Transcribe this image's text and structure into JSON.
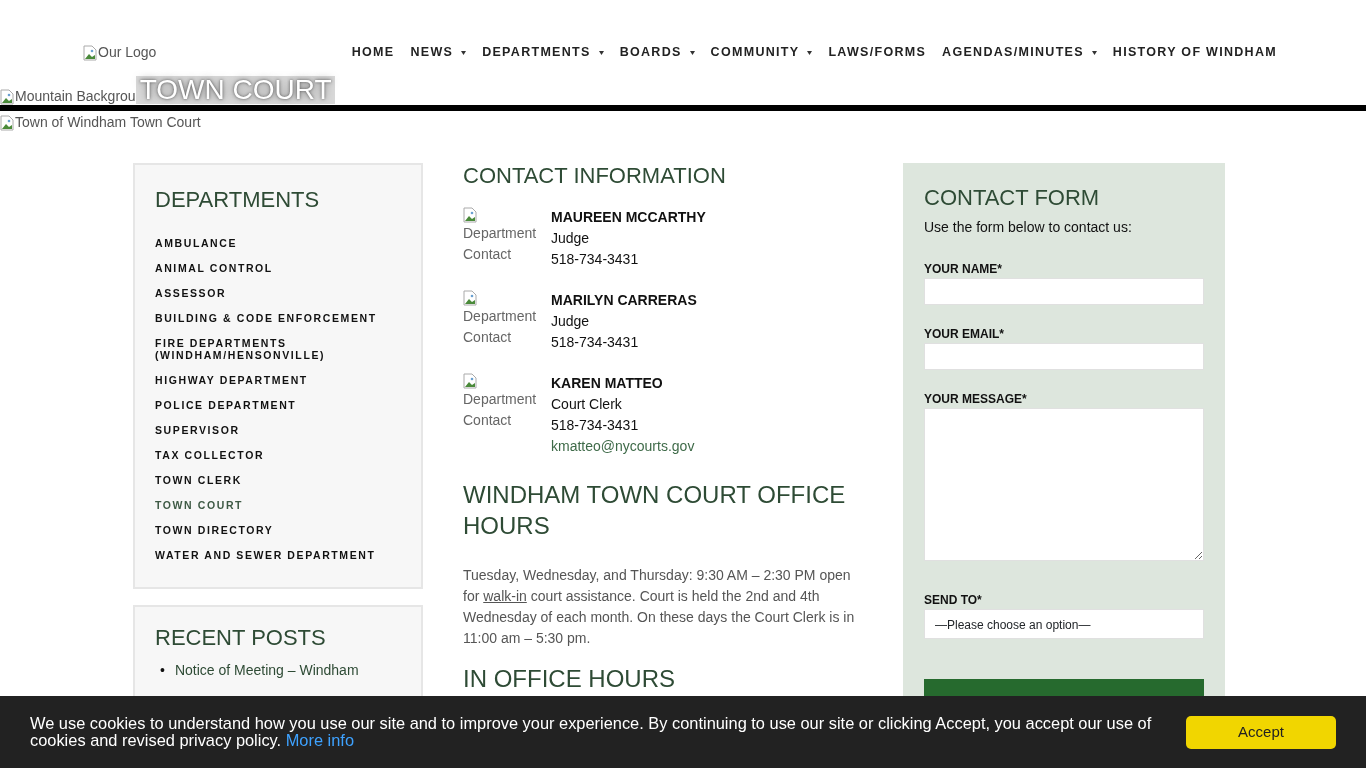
{
  "header": {
    "logo_alt": "Our Logo",
    "nav": [
      {
        "label": "HOME",
        "dropdown": false
      },
      {
        "label": "NEWS",
        "dropdown": true
      },
      {
        "label": "DEPARTMENTS",
        "dropdown": true
      },
      {
        "label": "BOARDS",
        "dropdown": true
      },
      {
        "label": "COMMUNITY",
        "dropdown": true
      },
      {
        "label": "LAWS/FORMS",
        "dropdown": false
      },
      {
        "label": "AGENDAS/MINUTES",
        "dropdown": true
      },
      {
        "label": "HISTORY OF WINDHAM",
        "dropdown": false
      }
    ]
  },
  "hero": {
    "background_alt": "Mountain Backgrou",
    "title": "TOWN COURT",
    "image_alt": "Town of Windham Town Court"
  },
  "sidebar": {
    "departments": {
      "title": "DEPARTMENTS",
      "items": [
        {
          "label": "AMBULANCE",
          "selected": false
        },
        {
          "label": "ANIMAL CONTROL",
          "selected": false
        },
        {
          "label": "ASSESSOR",
          "selected": false
        },
        {
          "label": "BUILDING & CODE ENFORCEMENT",
          "selected": false
        },
        {
          "label": "FIRE DEPARTMENTS (WINDHAM/HENSONVILLE)",
          "selected": false
        },
        {
          "label": "HIGHWAY DEPARTMENT",
          "selected": false
        },
        {
          "label": "POLICE DEPARTMENT",
          "selected": false
        },
        {
          "label": "SUPERVISOR",
          "selected": false
        },
        {
          "label": "TAX COLLECTOR",
          "selected": false
        },
        {
          "label": "TOWN CLERK",
          "selected": false
        },
        {
          "label": "TOWN COURT",
          "selected": true
        },
        {
          "label": "TOWN DIRECTORY",
          "selected": false
        },
        {
          "label": "WATER AND SEWER DEPARTMENT",
          "selected": false
        }
      ]
    },
    "recent_posts": {
      "title": "RECENT POSTS",
      "items": [
        {
          "marker": "•",
          "title": "Notice of Meeting – Windham"
        }
      ]
    }
  },
  "main": {
    "contact_title": "CONTACT INFORMATION",
    "contacts": [
      {
        "image_alt": "Department Contact",
        "name": "MAUREEN MCCARTHY",
        "role": "Judge",
        "phone": "518-734-3431"
      },
      {
        "image_alt": "Department Contact",
        "name": "MARILYN CARRERAS",
        "role": "Judge",
        "phone": "518-734-3431"
      },
      {
        "image_alt": "Department Contact",
        "name": "KAREN MATTEO",
        "role": "Court Clerk",
        "phone": "518-734-3431",
        "email": "kmatteo@nycourts.gov"
      }
    ],
    "hours_title": "WINDHAM TOWN COURT OFFICE HOURS",
    "hours_text": [
      {
        "kind": "text",
        "text": "Tuesday, Wednesday, and Thursday: 9:30 AM – 2:30 PM open for "
      },
      {
        "kind": "link",
        "text": "walk-in"
      },
      {
        "kind": "text",
        "text": " court assistance. Court is held the 2nd and 4th Wednesday of each month. On these days the Court Clerk is in 11:00 am – 5:30 pm."
      }
    ],
    "in_office_title": "IN OFFICE HOURS"
  },
  "contact_form": {
    "title": "CONTACT FORM",
    "intro": "Use the form below to contact us:",
    "fields": [
      {
        "label": "YOUR NAME*",
        "kind": "text"
      },
      {
        "label": "YOUR EMAIL*",
        "kind": "text"
      },
      {
        "label": "YOUR MESSAGE*",
        "kind": "textarea"
      },
      {
        "label": "SEND TO*",
        "kind": "select",
        "value": "—Please choose an option—"
      }
    ]
  },
  "cookie_banner": {
    "text": "We use cookies to understand how you use our site and to improve your experience. By continuing to use our site or clicking Accept, you accept our use of cookies and revised privacy policy.",
    "link": "More info",
    "button": "Accept"
  }
}
